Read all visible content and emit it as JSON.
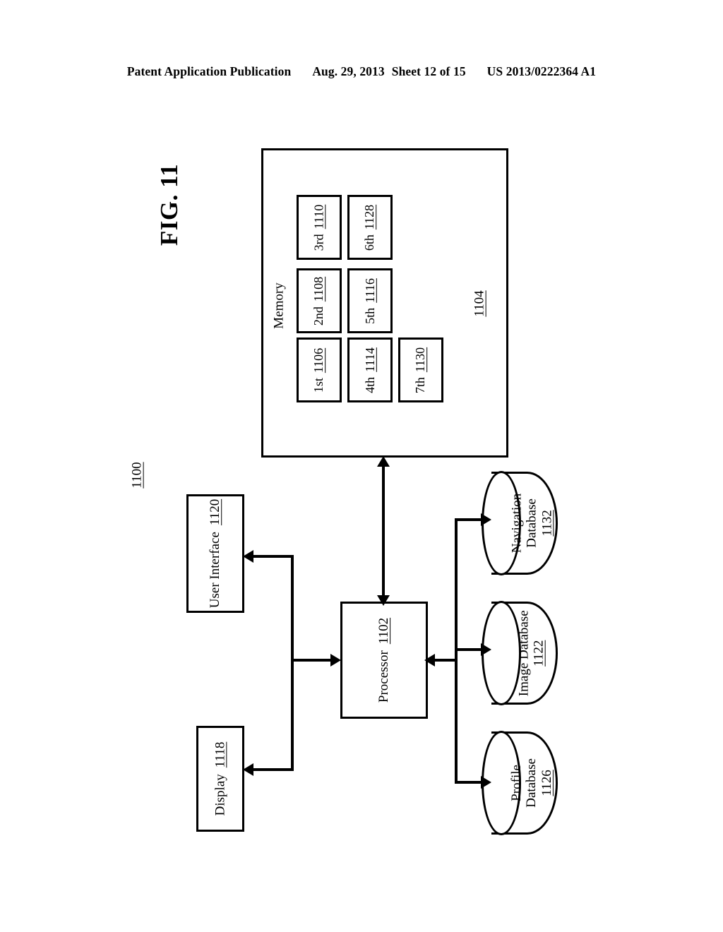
{
  "header": {
    "publication": "Patent Application Publication",
    "date": "Aug. 29, 2013",
    "sheet": "Sheet 12 of 15",
    "patent_number": "US 2013/0222364 A1"
  },
  "figure": {
    "label": "FIG. 11",
    "system_ref": "1100"
  },
  "memory": {
    "label": "Memory",
    "ref": "1104",
    "modules": [
      {
        "label": "1st",
        "ref": "1106"
      },
      {
        "label": "2nd",
        "ref": "1108"
      },
      {
        "label": "3rd",
        "ref": "1110"
      },
      {
        "label": "4th",
        "ref": "1114"
      },
      {
        "label": "5th",
        "ref": "1116"
      },
      {
        "label": "6th",
        "ref": "1128"
      },
      {
        "label": "7th",
        "ref": "1130"
      }
    ]
  },
  "blocks": {
    "processor": {
      "label": "Processor",
      "ref": "1102"
    },
    "user_interface": {
      "label": "User Interface",
      "ref": "1120"
    },
    "display": {
      "label": "Display",
      "ref": "1118"
    }
  },
  "databases": [
    {
      "line1": "Navigation",
      "line2": "Database",
      "ref": "1132"
    },
    {
      "line1": "Image Database",
      "line2": "",
      "ref": "1122"
    },
    {
      "line1": "Profile",
      "line2": "Database",
      "ref": "1126"
    }
  ],
  "colors": {
    "ink": "#000000",
    "paper": "#ffffff"
  }
}
